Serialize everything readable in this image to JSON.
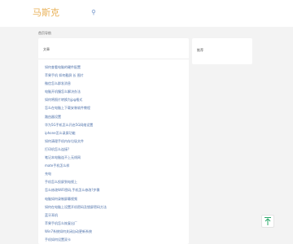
{
  "header": {
    "logo_text": "马斯克",
    "search_icon": "search-icon"
  },
  "breadcrumb": "首页导航",
  "main": {
    "title": "文章",
    "items": [
      "如何查看电脑的硬件配置",
      "苹果手机 如何截屏 长 图片",
      "微信怎么群发消息",
      "电脑开机慢怎么解决办法",
      "如何将照片转换为jpg格式",
      "怎么在电脑上下载安装软件教程",
      "路由器设置",
      "华为5G手机怎么开启5G网络设置",
      "iphone怎么录屏功能",
      "如何清理手机内存垃圾文件",
      "打印机怎么连接?",
      "笔记本电脑连不上无线网",
      "mate手机怎么样",
      "充电",
      "手机怎么投屏到电视上",
      "怎么修改WiFi密码,手机怎么修改?步骤",
      "电脑如何录制屏幕视频",
      "如何在电脑上设置开机密码及锁屏密码方法",
      "蓝牙耳机",
      "苹果手机怎么恢复出厂",
      "Win7系统如何关闭自动更新系统",
      "手机如何设置双卡"
    ]
  },
  "side": {
    "title": "推荐"
  },
  "to_top_icon": "arrow-up-icon"
}
